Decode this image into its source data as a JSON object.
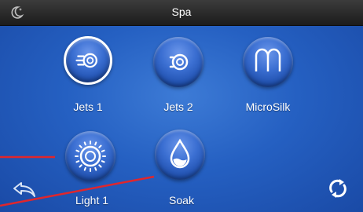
{
  "header": {
    "title": "Spa",
    "left_icon": "moon-icon"
  },
  "buttons": [
    {
      "id": "jets1",
      "label": "Jets 1",
      "icon": "jets-icon",
      "active": true
    },
    {
      "id": "jets2",
      "label": "Jets 2",
      "icon": "jets-icon",
      "active": false
    },
    {
      "id": "microsilk",
      "label": "MicroSilk",
      "icon": "microsilk-icon",
      "active": false
    },
    {
      "id": "light1",
      "label": "Light 1",
      "icon": "light-icon",
      "active": false
    },
    {
      "id": "soak",
      "label": "Soak",
      "icon": "water-drop-icon",
      "active": false
    }
  ],
  "footer": {
    "back_icon": "back-icon",
    "refresh_icon": "refresh-icon"
  },
  "colors": {
    "background": "#2560c2",
    "annotation_line": "#e0262c"
  }
}
